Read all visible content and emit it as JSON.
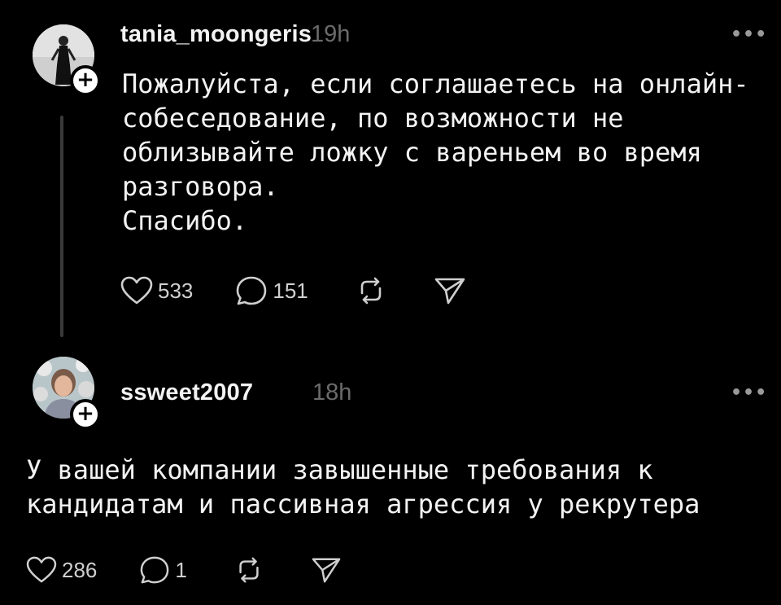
{
  "posts": [
    {
      "username": "tania_moongeris",
      "time": "19h",
      "text": "Пожалуйста, если соглашаетесь на онлайн-\nсобеседование, по возможности не\nоблизывайте ложку с вареньем во время\nразговора.\nСпасибо.",
      "likes": "533",
      "comments": "151",
      "follow_symbol": "+",
      "more_symbol": "•••"
    },
    {
      "username": "ssweet2007",
      "time": "18h",
      "text": "У вашей компании завышенные требования к\nкандидатам и пассивная агрессия у рекрутера",
      "likes": "286",
      "comments": "1",
      "follow_symbol": "+",
      "more_symbol": "•••"
    }
  ],
  "icons": [
    "heart-icon",
    "comment-icon",
    "repost-icon",
    "share-icon",
    "more-icon",
    "plus-icon"
  ],
  "colors": {
    "background": "#000000",
    "text": "#f3f3f3",
    "muted": "#6b6b6b",
    "thread_line": "#3a3a3a"
  }
}
